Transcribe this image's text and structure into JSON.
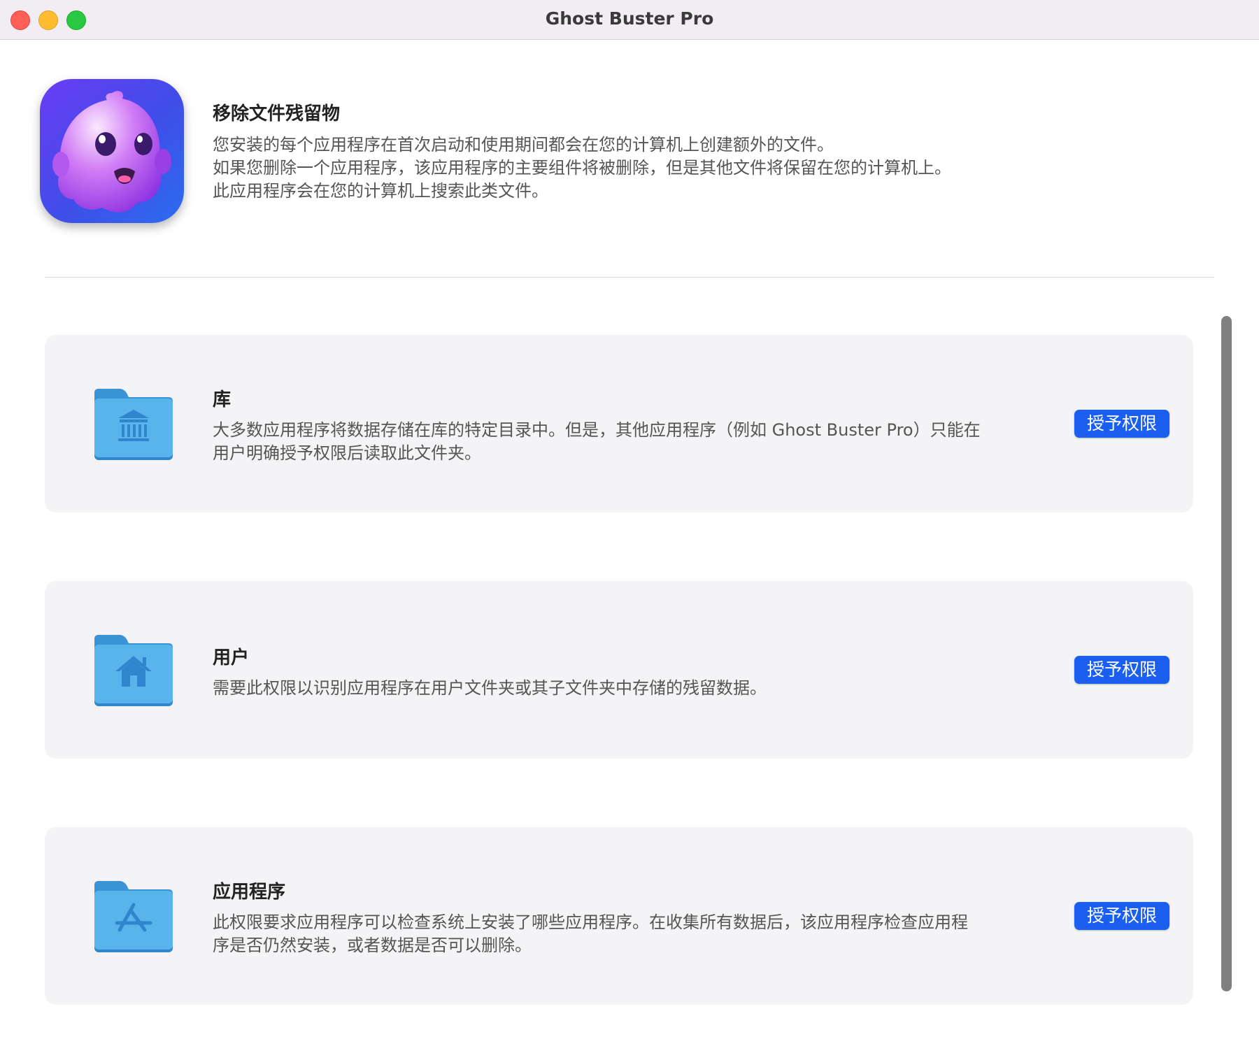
{
  "window": {
    "title": "Ghost Buster Pro"
  },
  "header": {
    "title": "移除文件残留物",
    "lines": [
      "您安装的每个应用程序在首次启动和使用期间都会在您的计算机上创建额外的文件。",
      "如果您删除一个应用程序，该应用程序的主要组件将被删除，但是其他文件将保留在您的计算机上。",
      "此应用程序会在您的计算机上搜索此类文件。"
    ]
  },
  "permissions": [
    {
      "title": "库",
      "icon": "library-folder-icon",
      "lines": [
        "大多数应用程序将数据存储在库的特定目录中。但是，其他应用程序（例如 Ghost Buster Pro）只能在",
        "用户明确授予权限后读取此文件夹。"
      ],
      "button": "授予权限"
    },
    {
      "title": "用户",
      "icon": "home-folder-icon",
      "lines": [
        "需要此权限以识别应用程序在用户文件夹或其子文件夹中存储的残留数据。"
      ],
      "button": "授予权限"
    },
    {
      "title": "应用程序",
      "icon": "applications-folder-icon",
      "lines": [
        "此权限要求应用程序可以检查系统上安装了哪些应用程序。在收集所有数据后，该应用程序检查应用程",
        "序是否仍然安装，或者数据是否可以删除。"
      ],
      "button": "授予权限"
    }
  ],
  "colors": {
    "accent": "#1a5ff0",
    "folder": "#5ab4ec",
    "card_bg": "#f4f4f6"
  }
}
